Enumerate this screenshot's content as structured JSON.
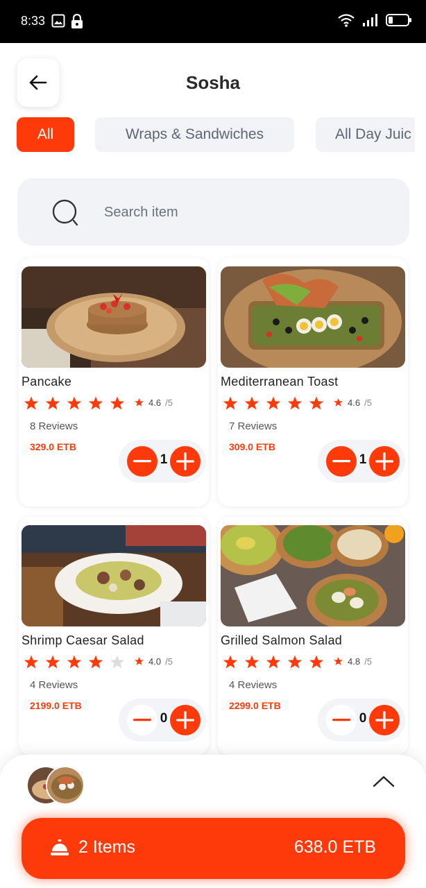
{
  "status_bar": {
    "time": "8:33"
  },
  "header": {
    "title": "Sosha"
  },
  "categories": [
    {
      "label": "All",
      "active": true
    },
    {
      "label": "Wraps & Sandwiches",
      "active": false
    },
    {
      "label": "All Day Juic",
      "active": false
    }
  ],
  "search": {
    "placeholder": "Search item",
    "value": ""
  },
  "products": [
    {
      "name": "Pancake",
      "stars": 5,
      "rating": "4.6",
      "rating_suffix": "/5",
      "reviews": "8 Reviews",
      "price": "329.0 ETB",
      "quantity": "1"
    },
    {
      "name": "Mediterranean Toast",
      "stars": 5,
      "rating": "4.6",
      "rating_suffix": "/5",
      "reviews": "7 Reviews",
      "price": "309.0 ETB",
      "quantity": "1"
    },
    {
      "name": "Shrimp Caesar Salad",
      "stars": 4,
      "rating": "4.0",
      "rating_suffix": "/5",
      "reviews": "4 Reviews",
      "price": "2199.0 ETB",
      "quantity": "0"
    },
    {
      "name": "Grilled Salmon Salad",
      "stars": 5,
      "rating": "4.8",
      "rating_suffix": "/5",
      "reviews": "4 Reviews",
      "price": "2299.0 ETB",
      "quantity": "0"
    }
  ],
  "cart": {
    "items_label": "2 Items",
    "total": "638.0 ETB"
  },
  "colors": {
    "accent": "#ff3a0a",
    "chip_bg": "#f1f3f6",
    "star_empty": "#dddddd"
  }
}
